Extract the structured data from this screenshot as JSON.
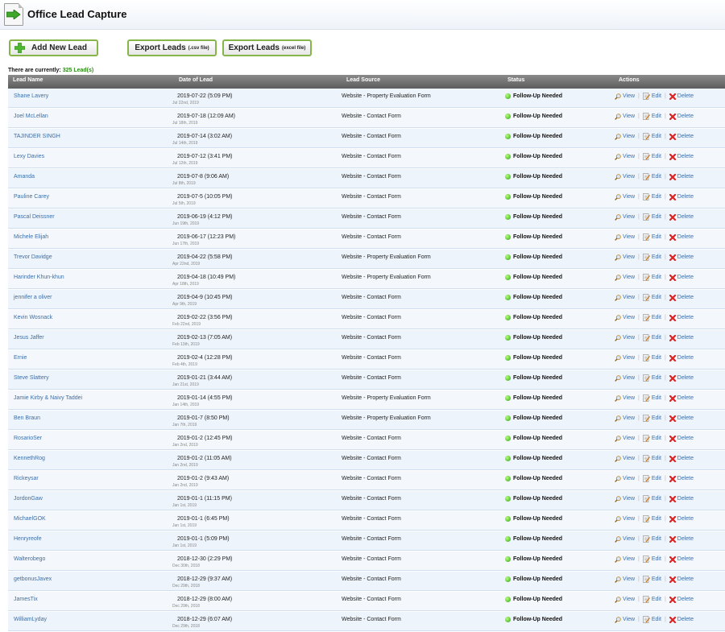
{
  "app": {
    "title": "Office Lead Capture"
  },
  "toolbar": {
    "add_label": "Add New Lead",
    "export_csv_label": "Export Leads",
    "export_csv_suffix": "(.csv file)",
    "export_xls_label": "Export Leads",
    "export_xls_suffix": "(excel file)"
  },
  "summary": {
    "prefix": "There are currently:",
    "count": "325 Lead(s)"
  },
  "table": {
    "headers": [
      "Lead Name",
      "Date of Lead",
      "Lead Source",
      "Status",
      "Actions"
    ],
    "action_labels": {
      "view": "View",
      "edit": "Edit",
      "delete": "Delete"
    },
    "rows": [
      {
        "name": "Shane Lavery",
        "date": "2019-07-22 (5:09 PM)",
        "sub": "Jul 22nd, 2019",
        "source": "Website - Property Evaluation Form",
        "status": "Follow-Up Needed"
      },
      {
        "name": "Joel McLellan",
        "date": "2019-07-18 (12:09 AM)",
        "sub": "Jul 18th, 2019",
        "source": "Website - Contact Form",
        "status": "Follow-Up Needed"
      },
      {
        "name": "TAJINDER SINGH",
        "date": "2019-07-14 (3:02 AM)",
        "sub": "Jul 14th, 2019",
        "source": "Website - Contact Form",
        "status": "Follow-Up Needed"
      },
      {
        "name": "Lexy Davies",
        "date": "2019-07-12 (3:41 PM)",
        "sub": "Jul 12th, 2019",
        "source": "Website - Contact Form",
        "status": "Follow-Up Needed"
      },
      {
        "name": "Amanda",
        "date": "2019-07-8 (9:06 AM)",
        "sub": "Jul 8th, 2019",
        "source": "Website - Contact Form",
        "status": "Follow-Up Needed"
      },
      {
        "name": "Pauline Carey",
        "date": "2019-07-5 (10:05 PM)",
        "sub": "Jul 5th, 2019",
        "source": "Website - Contact Form",
        "status": "Follow-Up Needed"
      },
      {
        "name": "Pascal Deissner",
        "date": "2019-06-19 (4:12 PM)",
        "sub": "Jun 19th, 2019",
        "source": "Website - Contact Form",
        "status": "Follow-Up Needed"
      },
      {
        "name": "Michele Elijah",
        "date": "2019-06-17 (12:23 PM)",
        "sub": "Jun 17th, 2019",
        "source": "Website - Contact Form",
        "status": "Follow-Up Needed"
      },
      {
        "name": "Trevor Davidge",
        "date": "2019-04-22 (5:58 PM)",
        "sub": "Apr 22nd, 2019",
        "source": "Website - Property Evaluation Form",
        "status": "Follow-Up Needed"
      },
      {
        "name": "Harinder Khun-khun",
        "date": "2019-04-18 (10:49 PM)",
        "sub": "Apr 18th, 2019",
        "source": "Website - Property Evaluation Form",
        "status": "Follow-Up Needed"
      },
      {
        "name": "jennifer a oliver",
        "date": "2019-04-9 (10:45 PM)",
        "sub": "Apr 9th, 2019",
        "source": "Website - Contact Form",
        "status": "Follow-Up Needed"
      },
      {
        "name": "Kevin Wosnack",
        "date": "2019-02-22 (3:56 PM)",
        "sub": "Feb 22nd, 2019",
        "source": "Website - Contact Form",
        "status": "Follow-Up Needed"
      },
      {
        "name": "Jesus Jaffer",
        "date": "2019-02-13 (7:05 AM)",
        "sub": "Feb 13th, 2019",
        "source": "Website - Contact Form",
        "status": "Follow-Up Needed"
      },
      {
        "name": "Ernie",
        "date": "2019-02-4 (12:28 PM)",
        "sub": "Feb 4th, 2019",
        "source": "Website - Contact Form",
        "status": "Follow-Up Needed"
      },
      {
        "name": "Steve Slattery",
        "date": "2019-01-21 (3:44 AM)",
        "sub": "Jan 21st, 2019",
        "source": "Website - Contact Form",
        "status": "Follow-Up Needed"
      },
      {
        "name": "Jamie Kirby & Naivy Taddei",
        "date": "2019-01-14 (4:55 PM)",
        "sub": "Jan 14th, 2019",
        "source": "Website - Property Evaluation Form",
        "status": "Follow-Up Needed"
      },
      {
        "name": "Ben Braun",
        "date": "2019-01-7 (8:50 PM)",
        "sub": "Jan 7th, 2019",
        "source": "Website - Property Evaluation Form",
        "status": "Follow-Up Needed"
      },
      {
        "name": "RosarioSer",
        "date": "2019-01-2 (12:45 PM)",
        "sub": "Jan 2nd, 2019",
        "source": "Website - Contact Form",
        "status": "Follow-Up Needed"
      },
      {
        "name": "KennethRog",
        "date": "2019-01-2 (11:05 AM)",
        "sub": "Jan 2nd, 2019",
        "source": "Website - Contact Form",
        "status": "Follow-Up Needed"
      },
      {
        "name": "Rickeysar",
        "date": "2019-01-2 (9:43 AM)",
        "sub": "Jan 2nd, 2019",
        "source": "Website - Contact Form",
        "status": "Follow-Up Needed"
      },
      {
        "name": "JordonGaw",
        "date": "2019-01-1 (11:15 PM)",
        "sub": "Jan 1st, 2019",
        "source": "Website - Contact Form",
        "status": "Follow-Up Needed"
      },
      {
        "name": "MichaelGOK",
        "date": "2019-01-1 (6:45 PM)",
        "sub": "Jan 1st, 2019",
        "source": "Website - Contact Form",
        "status": "Follow-Up Needed"
      },
      {
        "name": "Henryreofe",
        "date": "2019-01-1 (5:09 PM)",
        "sub": "Jan 1st, 2019",
        "source": "Website - Contact Form",
        "status": "Follow-Up Needed"
      },
      {
        "name": "Walterobego",
        "date": "2018-12-30 (2:29 PM)",
        "sub": "Dec 30th, 2018",
        "source": "Website - Contact Form",
        "status": "Follow-Up Needed"
      },
      {
        "name": "getbonusJavex",
        "date": "2018-12-29 (9:37 AM)",
        "sub": "Dec 29th, 2018",
        "source": "Website - Contact Form",
        "status": "Follow-Up Needed"
      },
      {
        "name": "JamesTix",
        "date": "2018-12-29 (8:00 AM)",
        "sub": "Dec 29th, 2018",
        "source": "Website - Contact Form",
        "status": "Follow-Up Needed"
      },
      {
        "name": "WilliamLyday",
        "date": "2018-12-29 (6:07 AM)",
        "sub": "Dec 29th, 2018",
        "source": "Website - Contact Form",
        "status": "Follow-Up Needed"
      }
    ]
  }
}
